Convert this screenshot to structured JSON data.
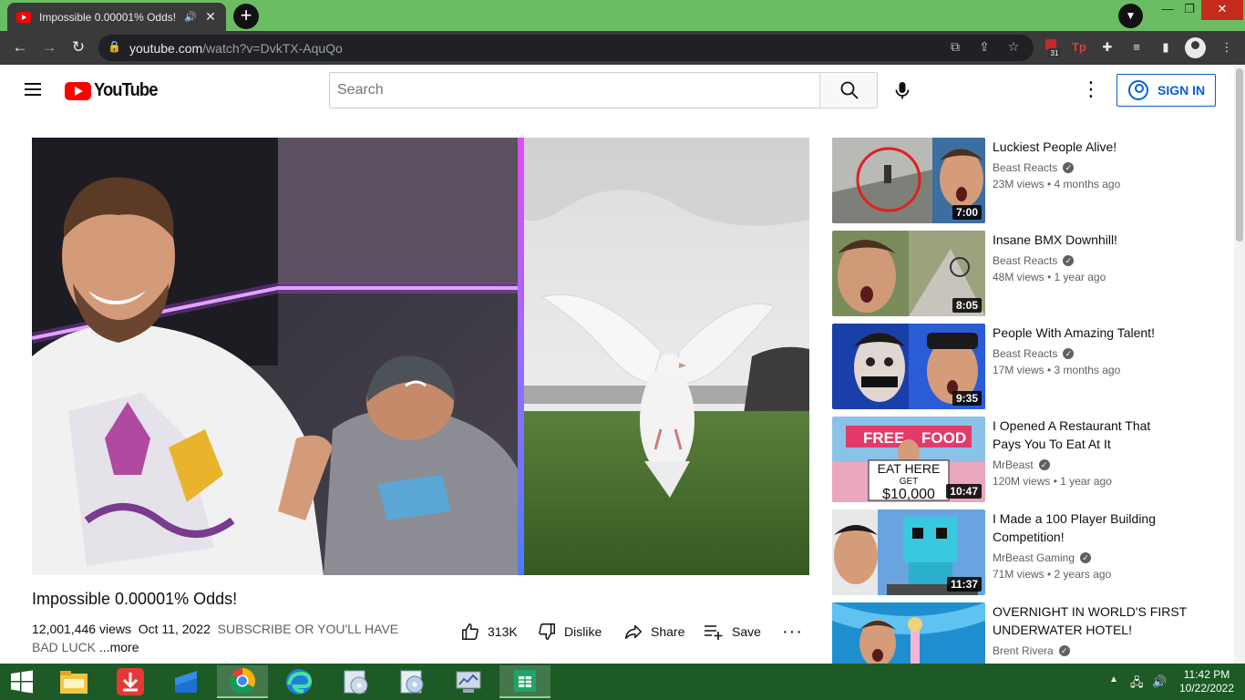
{
  "browser": {
    "tab_title": "Impossible 0.00001% Odds!",
    "url_host": "youtube.com",
    "url_path": "/watch?v=DvkTX-AquQo",
    "ext_badge": "31"
  },
  "header": {
    "logo_text": "YouTube",
    "search_placeholder": "Search",
    "signin_label": "SIGN IN"
  },
  "video": {
    "title": "Impossible 0.00001% Odds!",
    "views": "12,001,446 views",
    "date": "Oct 11, 2022",
    "description": "SUBSCRIBE OR YOU'LL HAVE BAD LUCK",
    "more_label": "...more",
    "likes": "313K",
    "dislike_label": "Dislike",
    "share_label": "Share",
    "save_label": "Save"
  },
  "recommendations": [
    {
      "title_line1": "Luckiest People Alive!",
      "title_line2": "",
      "channel": "Beast Reacts",
      "stats": "23M views • 4 months ago",
      "duration": "7:00"
    },
    {
      "title_line1": "Insane BMX Downhill!",
      "title_line2": "",
      "channel": "Beast Reacts",
      "stats": "48M views • 1 year ago",
      "duration": "8:05"
    },
    {
      "title_line1": "People With Amazing Talent!",
      "title_line2": "",
      "channel": "Beast Reacts",
      "stats": "17M views • 3 months ago",
      "duration": "9:35"
    },
    {
      "title_line1": "I Opened A Restaurant That",
      "title_line2": "Pays You To Eat At It",
      "channel": "MrBeast",
      "stats": "120M views • 1 year ago",
      "duration": "10:47",
      "thumb_text_1": "FREE",
      "thumb_text_2": "FOOD",
      "thumb_text_3": "EAT HERE",
      "thumb_text_4": "GET",
      "thumb_text_5": "$10,000"
    },
    {
      "title_line1": "I Made a 100 Player Building",
      "title_line2": "Competition!",
      "channel": "MrBeast Gaming",
      "stats": "71M views • 2 years ago",
      "duration": "11:37"
    },
    {
      "title_line1": "OVERNIGHT IN WORLD'S FIRST",
      "title_line2": "UNDERWATER HOTEL!",
      "channel": "Brent Rivera",
      "stats": "",
      "duration": ""
    }
  ],
  "taskbar": {
    "time": "11:42 PM",
    "date": "10/22/2022"
  },
  "colors": {
    "chrome_frame": "#6abd62",
    "chrome_toolbar": "#3a3a3a",
    "yt_red": "#ff0000",
    "signin_blue": "#065fd4",
    "taskbar": "#1d5a26"
  }
}
